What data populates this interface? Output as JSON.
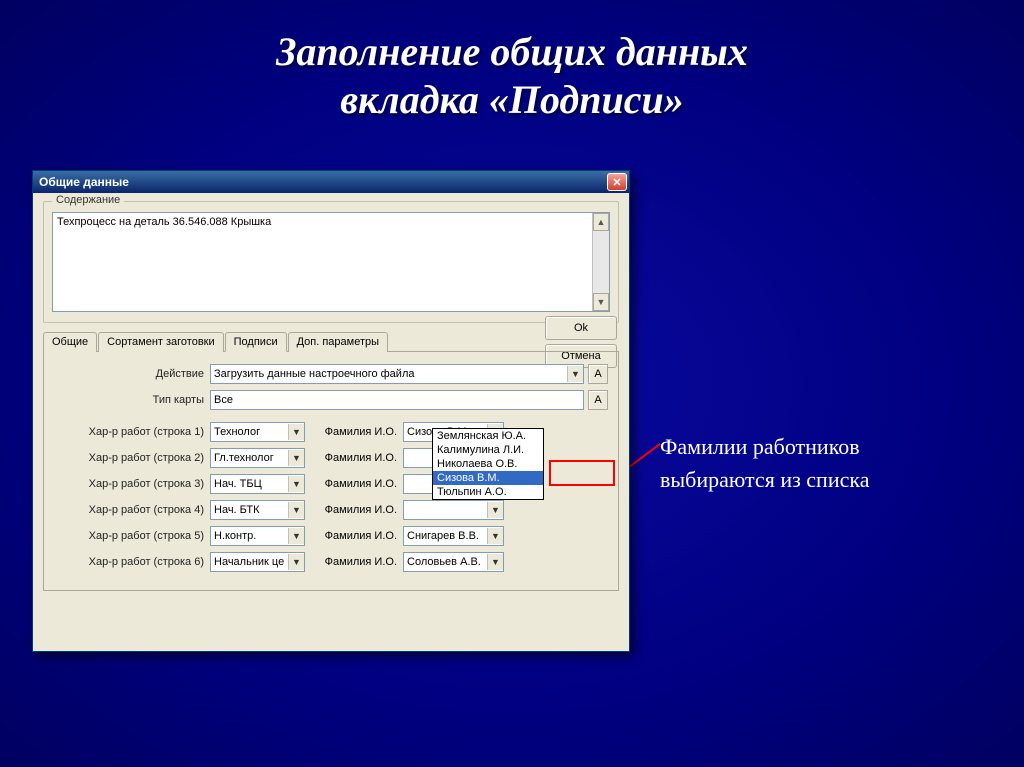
{
  "slide": {
    "title_line1": "Заполнение общих данных",
    "title_line2": "вкладка «Подписи»"
  },
  "annotation": {
    "line1": "Фамилии работников",
    "line2": "выбираются из списка"
  },
  "dialog": {
    "title": "Общие данные",
    "group_label": "Содержание",
    "content_text": "Техпроцесс на деталь 36.546.088 Крышка",
    "ok_label": "Ok",
    "cancel_label": "Отмена",
    "tabs": {
      "t1": "Общие",
      "t2": "Сортамент заготовки",
      "t3": "Подписи",
      "t4": "Доп. параметры"
    },
    "action_label": "Действие",
    "action_value": "Загрузить данные настроечного файла",
    "a_button": "А",
    "card_type_label": "Тип карты",
    "card_type_value": "Все",
    "rows": [
      {
        "label": "Хар-р работ (строка 1)",
        "role": "Технолог",
        "name_label": "Фамилия И.О.",
        "name": "Сизова В.М."
      },
      {
        "label": "Хар-р работ (строка 2)",
        "role": "Гл.технолог",
        "name_label": "Фамилия И.О.",
        "name": ""
      },
      {
        "label": "Хар-р работ (строка 3)",
        "role": "Нач. ТБЦ",
        "name_label": "Фамилия И.О.",
        "name": ""
      },
      {
        "label": "Хар-р работ (строка 4)",
        "role": "Нач. БТК",
        "name_label": "Фамилия И.О.",
        "name": ""
      },
      {
        "label": "Хар-р работ (строка 5)",
        "role": "Н.контр.",
        "name_label": "Фамилия И.О.",
        "name": "Снигарев В.В."
      },
      {
        "label": "Хар-р работ (строка 6)",
        "role": "Начальник це",
        "name_label": "Фамилия И.О.",
        "name": "Соловьев А.В."
      }
    ],
    "dropdown_options": [
      "Землянская Ю.А.",
      "Калимулина Л.И.",
      "Николаева О.В.",
      "Сизова В.М.",
      "Тюльпин А.О."
    ],
    "dropdown_selected_index": 3
  }
}
